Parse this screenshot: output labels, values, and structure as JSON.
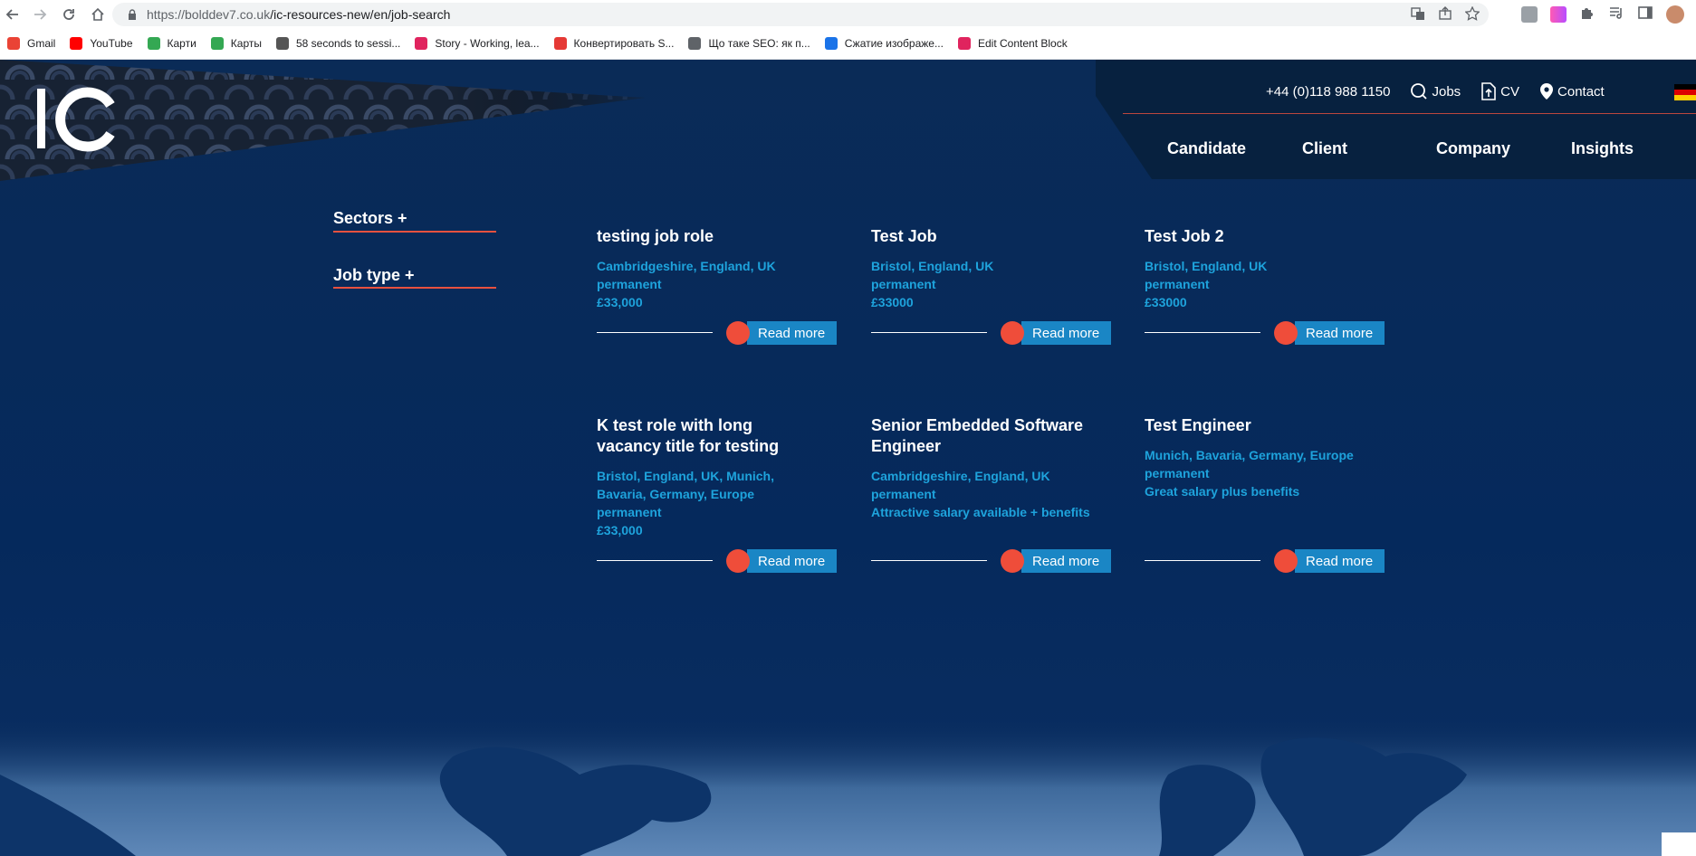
{
  "browser": {
    "url_host": "https://bolddev7.co.uk",
    "url_path": "/ic-resources-new/en/job-search",
    "bookmarks": [
      {
        "label": "Gmail",
        "color": "#ea4335"
      },
      {
        "label": "YouTube",
        "color": "#ff0000"
      },
      {
        "label": "Карти",
        "color": "#34a853"
      },
      {
        "label": "Карты",
        "color": "#34a853"
      },
      {
        "label": "58 seconds to sessi...",
        "color": "#555555"
      },
      {
        "label": "Story - Working, lea...",
        "color": "#e0245e"
      },
      {
        "label": "Конвертировать S...",
        "color": "#e53935"
      },
      {
        "label": "Що таке SEO: як п...",
        "color": "#5f6368"
      },
      {
        "label": "Сжатие изображе...",
        "color": "#1a73e8"
      },
      {
        "label": "Edit Content Block",
        "color": "#e0245e"
      }
    ]
  },
  "header": {
    "phone": "+44 (0)118 988 1150",
    "jobs_label": "Jobs",
    "cv_label": "CV",
    "contact_label": "Contact",
    "nav": {
      "candidate": "Candidate",
      "client": "Client",
      "company": "Company",
      "insights": "Insights"
    }
  },
  "filters": {
    "sectors": "Sectors +",
    "job_type": "Job type +"
  },
  "jobs": [
    {
      "title": "testing job role",
      "location": "Cambridgeshire, England, UK",
      "type": "permanent",
      "salary": "£33,000",
      "cta": "Read more"
    },
    {
      "title": "Test Job",
      "location": "Bristol, England, UK",
      "type": "permanent",
      "salary": "£33000",
      "cta": "Read more"
    },
    {
      "title": "Test Job 2",
      "location": "Bristol, England, UK",
      "type": "permanent",
      "salary": "£33000",
      "cta": "Read more"
    },
    {
      "title_line1": "K test role with long",
      "title_line2": "vacancy title for testing",
      "location_line1": "Bristol, England, UK, Munich,",
      "location_line2": "Bavaria, Germany, Europe",
      "type": "permanent",
      "salary": "£33,000",
      "cta": "Read more"
    },
    {
      "title_line1": "Senior Embedded Software",
      "title_line2": "Engineer",
      "location": "Cambridgeshire, England, UK",
      "type": "permanent",
      "salary": "Attractive salary available + benefits",
      "cta": "Read more"
    },
    {
      "title": "Test Engineer",
      "location": "Munich, Bavaria, Germany, Europe",
      "type": "permanent",
      "salary": "Great salary plus benefits",
      "cta": "Read more"
    }
  ],
  "colors": {
    "accent": "#ef4d3a",
    "link_blue": "#1ea3dc",
    "button_blue": "#1a86c5",
    "page_bg": "#0b2d5a"
  }
}
